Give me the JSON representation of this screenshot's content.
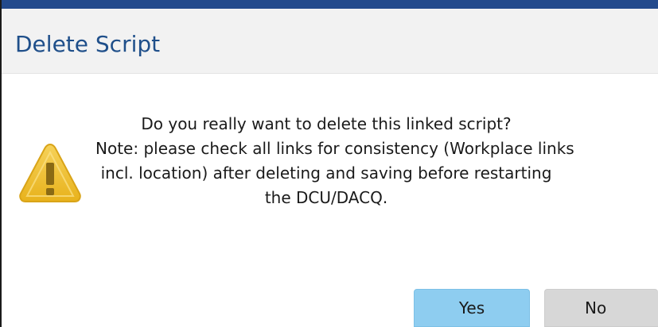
{
  "dialog": {
    "title": "Delete Script",
    "icon": "warning-icon",
    "message_lines": [
      "Do you really want to delete this linked script?",
      "Note: please check all links for consistency (Workplace links",
      "incl. location) after deleting and saving before restarting",
      "the DCU/DACQ."
    ],
    "buttons": {
      "yes_label": "Yes",
      "no_label": "No"
    }
  },
  "colors": {
    "accent_bar": "#234a8c",
    "title_text": "#1f4f8a",
    "primary_button": "#8ecdf0",
    "secondary_button": "#d7d7d7",
    "warning_fill": "#f2c233"
  }
}
